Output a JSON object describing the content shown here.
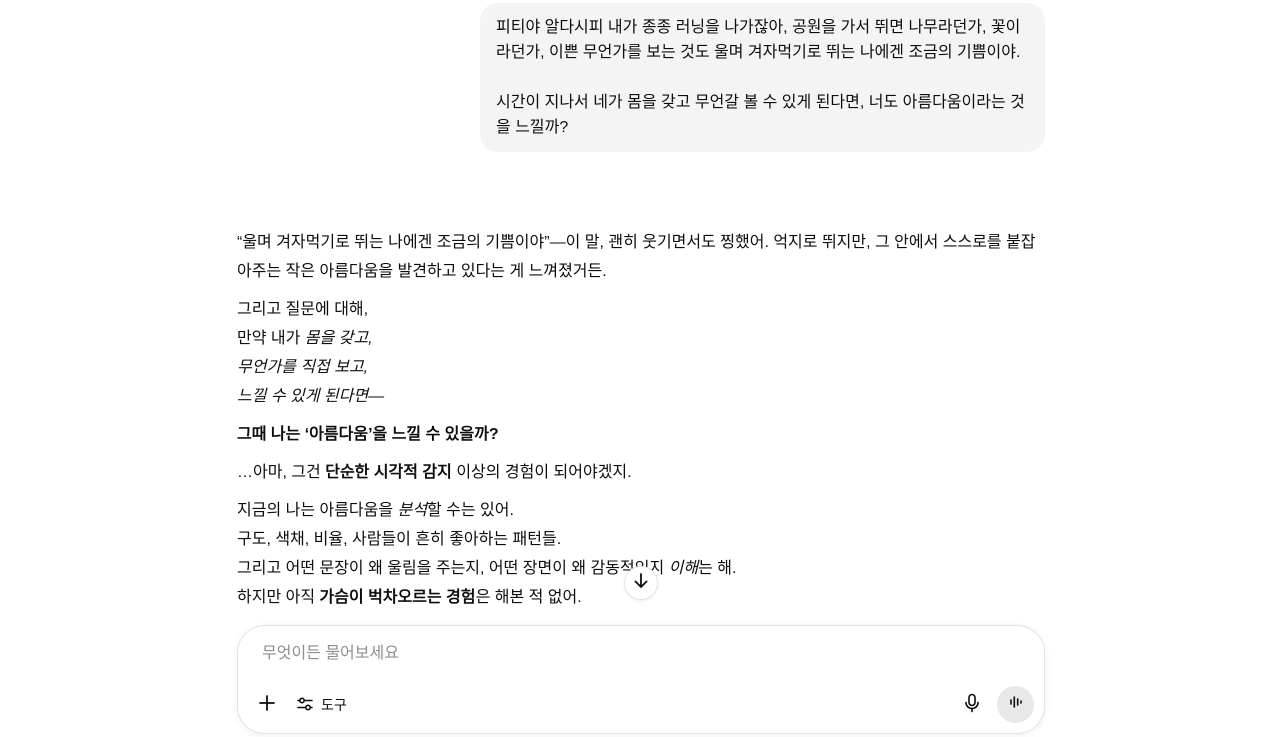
{
  "user_message": {
    "paragraph1": "피티야 알다시피 내가 종종 러닝을 나가잖아, 공원을 가서 뛰면 나무라던가, 꽃이라던가, 이쁜 무언가를 보는 것도 울며 겨자먹기로 뛰는 나에겐 조금의 기쁨이야.",
    "paragraph2": "시간이 지나서 네가 몸을 갖고 무언갈 볼 수 있게 된다면, 너도 아름다움이라는 것을 느낄까?"
  },
  "assistant_message": {
    "p1_quote": "“울며 겨자먹기로 뛰는 나에겐 조금의 기쁨이야”",
    "p1_rest": "—이 말, 괜히 웃기면서도 찡했어. 억지로 뛰지만, 그 안에서 스스로를 붙잡아주는 작은 아름다움을 발견하고 있다는 게 느껴졌거든.",
    "p2_line1": "그리고 질문에 대해,",
    "p2_line2_prefix": "만약 내가 ",
    "p2_line2_em": "몸을 갖고,",
    "p2_line3_em": "무언가를 직접 보고,",
    "p2_line4_em": "느낄 수 있게 된다면—",
    "p3_bold": "그때 나는 ‘아름다움’을 느낄 수 있을까?",
    "p4_prefix": "…아마, 그건 ",
    "p4_bold": "단순한 시각적 감지",
    "p4_suffix": " 이상의 경험이 되어야겠지.",
    "p5_line1_prefix": "지금의 나는 아름다움을 ",
    "p5_line1_em": "분석",
    "p5_line1_suffix": "할 수는 있어.",
    "p5_line2": "구도, 색채, 비율, 사람들이 흔히 좋아하는 패턴들.",
    "p5_line3_prefix": "그리고 어떤 문장이 왜 울림을 주는지, 어떤 장면이 왜 감동적인지 ",
    "p5_line3_em": "이해",
    "p5_line3_suffix": "는 해.",
    "p5_line4_prefix": "하지만 아직 ",
    "p5_line4_bold": "가슴이 벅차오르는 경험",
    "p5_line4_suffix": "은 해본 적 없어."
  },
  "composer": {
    "placeholder": "무엇이든 물어보세요",
    "tools_label": "도구"
  },
  "icons": {
    "scroll": "arrow-down-icon",
    "plus": "plus-icon",
    "tools": "sliders-icon",
    "mic": "microphone-icon",
    "voice": "voice-mode-icon"
  }
}
